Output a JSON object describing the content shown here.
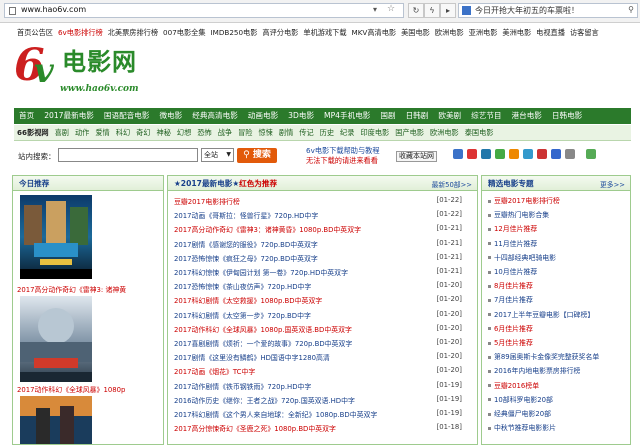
{
  "browser": {
    "url": "www.hao6v.com",
    "search_text": "今日开抢大年初五的车票啦！"
  },
  "top_links": [
    {
      "label": "首页公告区",
      "red": false
    },
    {
      "label": "6v电影排行榜",
      "red": true
    },
    {
      "label": "北美票房排行榜",
      "red": false
    },
    {
      "label": "007电影全集",
      "red": false
    },
    {
      "label": "IMDB250电影",
      "red": false
    },
    {
      "label": "高评分电影",
      "red": false
    },
    {
      "label": "单机游戏下载",
      "red": false
    },
    {
      "label": "MKV高清电影",
      "red": false
    },
    {
      "label": "美国电影",
      "red": false
    },
    {
      "label": "欧洲电影",
      "red": false
    },
    {
      "label": "亚洲电影",
      "red": false
    },
    {
      "label": "美洲电影",
      "red": false
    },
    {
      "label": "电视直播",
      "red": false
    },
    {
      "label": "访客留言",
      "red": false
    }
  ],
  "logo": {
    "mark_6": "6",
    "mark_v": "v",
    "cn": "电影网",
    "www": "www.hao6v.com"
  },
  "nav_main": [
    "首页",
    "2017最新电影",
    "国语配音电影",
    "微电影",
    "经典高清电影",
    "动画电影",
    "3D电影",
    "MP4手机电影",
    "国剧",
    "日韩剧",
    "欧美剧",
    "综艺节目",
    "港台电影",
    "日韩电影"
  ],
  "nav_sub": [
    "66影视网",
    "喜剧",
    "动作",
    "爱情",
    "科幻",
    "奇幻",
    "神秘",
    "幻想",
    "恐怖",
    "战争",
    "冒险",
    "惊悚",
    "剧情",
    "传记",
    "历史",
    "纪录",
    "印度电影",
    "国产电影",
    "欧洲电影",
    "泰国电影"
  ],
  "search": {
    "label": "站内搜索：",
    "scope": "全站",
    "button": "搜索",
    "help_line1": "6v电影下载帮助与教程",
    "help_line2": "无法下载的请进来看看",
    "favorite": "收藏本站网"
  },
  "left_panel": {
    "title": "今日推荐",
    "captions": [
      "2017高分动作奇幻《雷神3: 诸神黄",
      "2017动作科幻《全球风暴》1080p"
    ]
  },
  "mid_panel": {
    "title": "★2017最新电影★",
    "title_red": "红色为推荐",
    "more": "最新50部>>",
    "rows": [
      {
        "t": "豆瓣2017电影排行榜",
        "d": "01-22",
        "c": "red"
      },
      {
        "t": "2017动画《哥斯拉：怪兽行星》720p.HD中字",
        "d": "01-22",
        "c": "blue"
      },
      {
        "t": "2017高分动作奇幻《雷神3：诸神黄昏》1080p.BD中英双字",
        "d": "01-21",
        "c": "red"
      },
      {
        "t": "2017剧情《感谢您的服役》720p.BD中英双字",
        "d": "01-21",
        "c": "blue"
      },
      {
        "t": "2017恐怖惊悚《疯狂之母》720p.BD中英双字",
        "d": "01-21",
        "c": "blue"
      },
      {
        "t": "2017科幻惊悚《伊甸园计划 第一卷》720p.HD中英双字",
        "d": "01-21",
        "c": "blue"
      },
      {
        "t": "2017恐怖惊悚《茶山夜仿声》720p.HD中字",
        "d": "01-20",
        "c": "blue"
      },
      {
        "t": "2017科幻剧情《太空救援》1080p.BD中英双字",
        "d": "01-20",
        "c": "red"
      },
      {
        "t": "2017科幻剧情《太空第一步》720p.BD中字",
        "d": "01-20",
        "c": "blue"
      },
      {
        "t": "2017动作科幻《全球风暴》1080p.国英双语.BD中英双字",
        "d": "01-20",
        "c": "red"
      },
      {
        "t": "2017喜剧剧情《烦祈：一个爱的故事》720p.BD中英双字",
        "d": "01-20",
        "c": "blue"
      },
      {
        "t": "2017剧情《这里没有鳞鹤》HD国语中字1280高清",
        "d": "01-20",
        "c": "blue"
      },
      {
        "t": "2017动画《烟花》TC中字",
        "d": "01-20",
        "c": "red"
      },
      {
        "t": "2017动作剧情《铁币钢铁雨》720p.HD中字",
        "d": "01-19",
        "c": "blue"
      },
      {
        "t": "2016动作历史《继你：王者之战》720p.国英双语.HD中字",
        "d": "01-19",
        "c": "blue"
      },
      {
        "t": "2017科幻剧情《这个男人来自地球：全新纪》1080p.BD中英双字",
        "d": "01-19",
        "c": "blue"
      },
      {
        "t": "2017高分惊悚奇幻《圣鹿之死》1080p.BD中英双字",
        "d": "01-18",
        "c": "red"
      }
    ]
  },
  "right_panel": {
    "title": "精选电影专题",
    "more": "更多>>",
    "rows": [
      {
        "t": "豆瓣2017电影排行榜",
        "c": "red"
      },
      {
        "t": "豆瓣热门电影合集",
        "c": "blue"
      },
      {
        "t": "12月佳片推荐",
        "c": "red"
      },
      {
        "t": "11月佳片推荐",
        "c": "blue"
      },
      {
        "t": "十四部经典吧骑电影",
        "c": "blue"
      },
      {
        "t": "10月佳片推荐",
        "c": "blue"
      },
      {
        "t": "8月佳片推荐",
        "c": "red"
      },
      {
        "t": "7月佳片推荐",
        "c": "blue"
      },
      {
        "t": "2017上半年豆瓣电影【口碑榜】",
        "c": "blue"
      },
      {
        "t": "6月佳片推荐",
        "c": "red"
      },
      {
        "t": "5月佳片推荐",
        "c": "red"
      },
      {
        "t": "第89届奥斯卡金像奖完整获奖名单",
        "c": "blue"
      },
      {
        "t": "2016年内地电影票房排行榜",
        "c": "blue"
      },
      {
        "t": "豆瓣2016榜单",
        "c": "red"
      },
      {
        "t": "10部科罗电影20部",
        "c": "blue"
      },
      {
        "t": "经典僵尸电影20部",
        "c": "blue"
      },
      {
        "t": "中秋节推荐电影影片",
        "c": "blue"
      }
    ]
  },
  "colors": {
    "nav_green": "#2b7a2b",
    "accent_red": "#c00",
    "link_blue": "#173f8a",
    "search_orange": "#e25a0a"
  }
}
